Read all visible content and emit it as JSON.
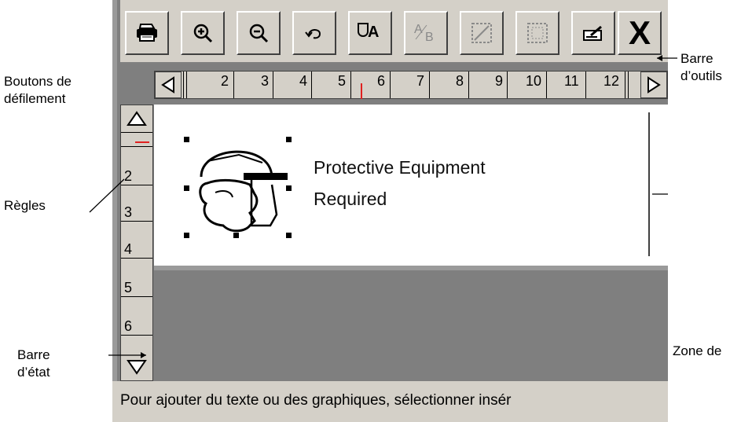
{
  "callouts": {
    "scroll_buttons": "Boutons de\ndéfilement",
    "toolbar": "Barre\nd’outils",
    "rulers": "Règles",
    "status_bar": "Barre\nd’état",
    "edit_zone": "Zone de"
  },
  "toolbar": {
    "buttons": [
      {
        "name": "print-icon"
      },
      {
        "name": "zoom-in-icon"
      },
      {
        "name": "zoom-out-icon"
      },
      {
        "name": "undo-icon"
      },
      {
        "name": "text-graphic-icon"
      },
      {
        "name": "text-subscript-icon"
      },
      {
        "name": "select-frame-icon"
      },
      {
        "name": "select-frame-alt-icon"
      },
      {
        "name": "edit-icon"
      },
      {
        "name": "close-icon",
        "label": "X"
      }
    ]
  },
  "horizontal_ruler": {
    "numbers": [
      "2",
      "3",
      "4",
      "5",
      "6",
      "7",
      "8",
      "9",
      "10",
      "11",
      "12"
    ]
  },
  "vertical_ruler": {
    "numbers": [
      "2",
      "3",
      "4",
      "5",
      "6"
    ]
  },
  "label": {
    "line1": "Protective Equipment",
    "line2": "Required"
  },
  "status": {
    "text": "Pour ajouter du texte ou des graphiques, sélectionner insér"
  },
  "colors": {
    "cursor_marker": "#e02020",
    "chrome": "#d4d0c8",
    "work_area": "#7f7f7f"
  }
}
